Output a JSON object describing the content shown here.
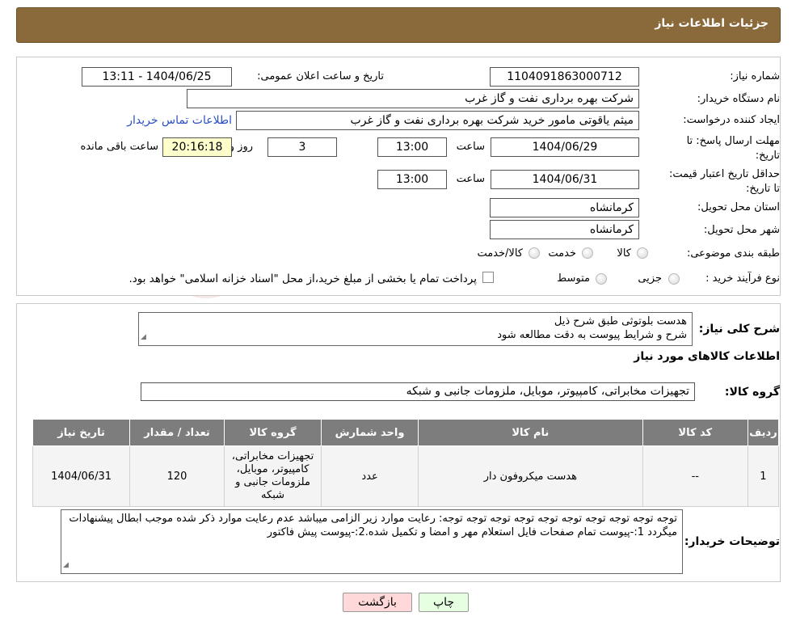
{
  "header": {
    "title": "جزئیات اطلاعات نیاز"
  },
  "need_info": {
    "need_number_label": "شماره نیاز:",
    "need_number": "1104091863000712",
    "announce_datetime_label": "تاریخ و ساعت اعلان عمومی:",
    "announce_datetime": "1404/06/25 - 13:11",
    "buyer_org_label": "نام دستگاه خریدار:",
    "buyer_org": "شرکت بهره برداری نفت و گاز غرب",
    "requester_label": "ایجاد کننده درخواست:",
    "requester": "میثم یاقوتی مامور خرید شرکت بهره برداری نفت و گاز غرب",
    "contact_link": "اطلاعات تماس خریدار",
    "reply_deadline_label": "مهلت ارسال پاسخ: تا تاریخ:",
    "reply_date": "1404/06/29",
    "time_label": "ساعت",
    "reply_time": "13:00",
    "days_value": "3",
    "days_label": "روز و",
    "remaining_time": "20:16:18",
    "remaining_label": "ساعت باقی مانده",
    "validity_label": "حداقل تاریخ اعتبار قیمت: تا تاریخ:",
    "validity_date": "1404/06/31",
    "validity_time": "13:00",
    "province_label": "استان محل تحویل:",
    "province": "کرمانشاه",
    "city_label": "شهر محل تحویل:",
    "city": "کرمانشاه",
    "category_label": "طبقه بندی موضوعی:",
    "category_options": [
      "کالا",
      "خدمت",
      "کالا/خدمت"
    ],
    "process_label": "نوع فرآیند خرید :",
    "process_options": [
      "جزیی",
      "متوسط"
    ],
    "process_note": "پرداخت تمام یا بخشی از مبلغ خرید،از محل \"اسناد خزانه اسلامی\" خواهد بود."
  },
  "description": {
    "label": "شرح کلی نیاز:",
    "line1": "هدست بلوتوثی طبق شرح ذیل",
    "line2": "شرح و شرایط پیوست به دقت مطالعه شود"
  },
  "goods": {
    "section_title": "اطلاعات کالاهای مورد نیاز",
    "group_label": "گروه کالا:",
    "group_value": "تجهیزات مخابراتی، کامپیوتر، موبایل، ملزومات جانبی و شبکه",
    "table": {
      "headers": [
        "ردیف",
        "کد کالا",
        "نام کالا",
        "واحد شمارش",
        "گروه کالا",
        "تعداد / مقدار",
        "تاریخ نیاز"
      ],
      "rows": [
        [
          "1",
          "--",
          "هدست میکروفون دار",
          "عدد",
          "تجهیزات مخابراتی، کامپیوتر، موبایل، ملزومات جانبی و شبکه",
          "120",
          "1404/06/31"
        ]
      ]
    }
  },
  "buyer_notes": {
    "label": "توضیحات خریدار:",
    "text": "توجه توجه توجه توجه توجه توجه توجه توجه توجه توجه: رعایت موارد زیر الزامی میباشد عدم رعایت موارد ذکر شده موجب ابطال پیشنهادات میگردد 1:-پیوست تمام صفحات  فایل استعلام مهر و امضا و تکمیل شده.2:-پیوست پیش فاکتور"
  },
  "buttons": {
    "print": "چاپ",
    "back": "بازگشت"
  },
  "colors": {
    "header_bg": "#8a6a3b",
    "table_header_bg": "#7d7d7d",
    "back_button_bg": "#ffd9d9",
    "print_button_bg": "#e6ffe0",
    "yellow_field": "#ffffcc",
    "link": "#2b4fc4"
  }
}
